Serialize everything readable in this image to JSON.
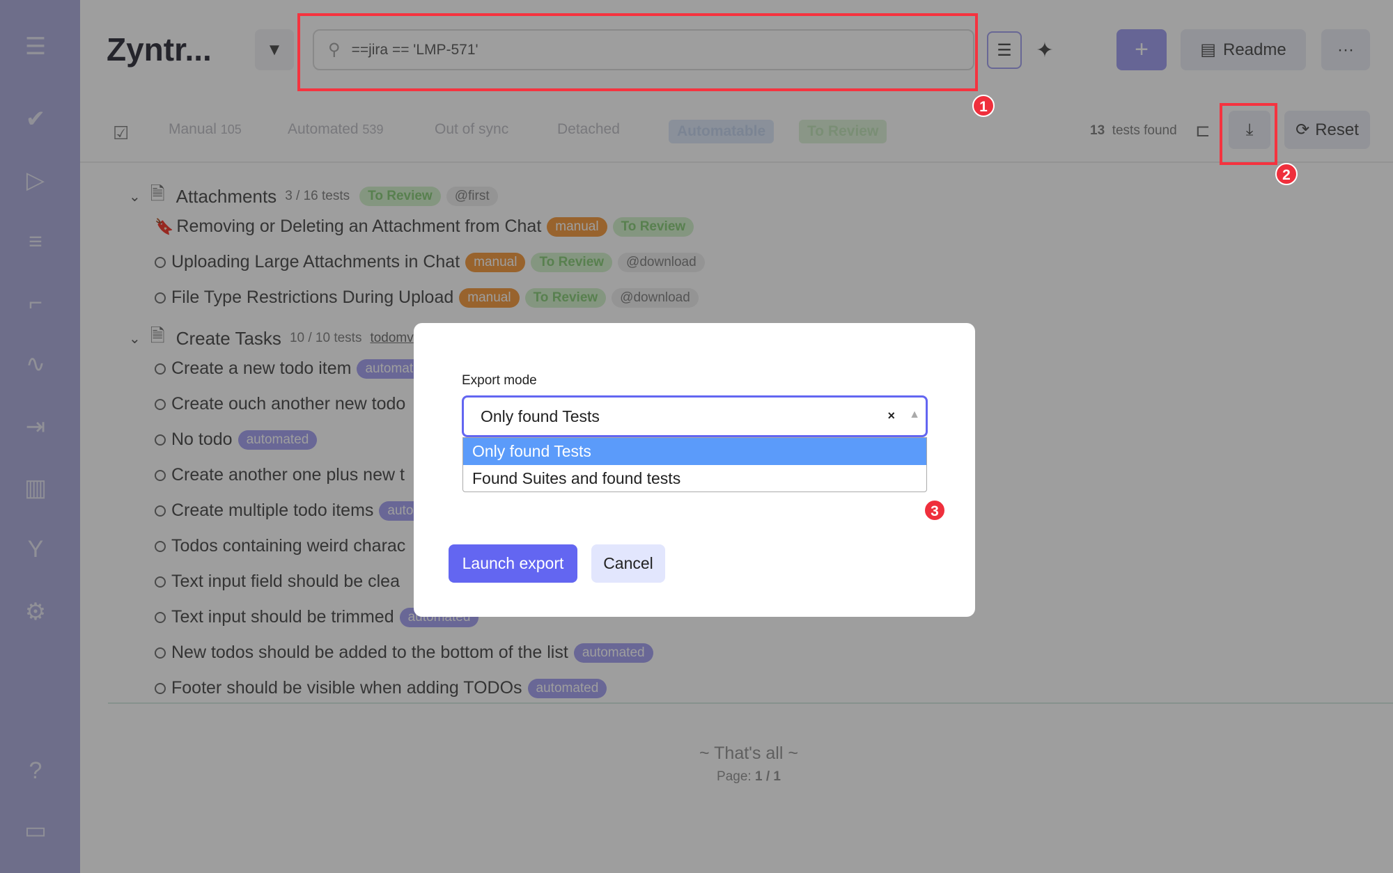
{
  "app": {
    "title": "Zyntr..."
  },
  "sidebar": {
    "items": [
      {
        "name": "menu",
        "glyph": "☰"
      },
      {
        "name": "tests",
        "glyph": "✔"
      },
      {
        "name": "runs",
        "glyph": "▷"
      },
      {
        "name": "plans",
        "glyph": "≡"
      },
      {
        "name": "steps",
        "glyph": "⌐"
      },
      {
        "name": "pulse",
        "glyph": "∿"
      },
      {
        "name": "imports",
        "glyph": "⇥"
      },
      {
        "name": "analytics",
        "glyph": "▥"
      },
      {
        "name": "branches",
        "glyph": "Y"
      },
      {
        "name": "settings",
        "glyph": "⚙"
      },
      {
        "name": "help",
        "glyph": "?"
      },
      {
        "name": "projects",
        "glyph": "▭"
      }
    ]
  },
  "header": {
    "search_value": "==jira == 'LMP-571'",
    "readme_label": "Readme",
    "more_label": "···",
    "plus_label": "+"
  },
  "tabs": [
    {
      "label": "Manual",
      "count": "105"
    },
    {
      "label": "Automated",
      "count": "539"
    },
    {
      "label": "Out of sync",
      "count": ""
    },
    {
      "label": "Detached",
      "count": ""
    }
  ],
  "pill_tabs": {
    "automatable": "Automatable",
    "to_review": "To Review"
  },
  "results": {
    "count": "13",
    "label": "tests found",
    "reset_label": "Reset"
  },
  "suites": [
    {
      "name": "Attachments",
      "count": "3 / 16 tests",
      "pills": [
        {
          "t": "To Review",
          "c": "review"
        },
        {
          "t": "@first",
          "c": "tag"
        }
      ],
      "tests": [
        {
          "name": "Removing or Deleting an Attachment from Chat",
          "flag": true,
          "pills": [
            {
              "t": "manual",
              "c": "manual"
            },
            {
              "t": "To Review",
              "c": "review"
            }
          ]
        },
        {
          "name": "Uploading Large Attachments in Chat",
          "pills": [
            {
              "t": "manual",
              "c": "manual"
            },
            {
              "t": "To Review",
              "c": "review"
            },
            {
              "t": "@download",
              "c": "tag"
            }
          ]
        },
        {
          "name": "File Type Restrictions During Upload",
          "pills": [
            {
              "t": "manual",
              "c": "manual"
            },
            {
              "t": "To Review",
              "c": "review"
            },
            {
              "t": "@download",
              "c": "tag"
            }
          ]
        }
      ]
    },
    {
      "name": "Create Tasks",
      "count": "10 / 10 tests",
      "link": "todomv",
      "pills": [],
      "tests": [
        {
          "name": "Create a new todo item",
          "pills": [
            {
              "t": "automated",
              "c": "auto"
            }
          ]
        },
        {
          "name": "Create ouch another new todo",
          "pills": []
        },
        {
          "name": "No todo",
          "pills": [
            {
              "t": "automated",
              "c": "auto"
            }
          ]
        },
        {
          "name": "Create another one plus new t",
          "pills": []
        },
        {
          "name": "Create multiple todo items",
          "pills": [
            {
              "t": "automated",
              "c": "auto"
            }
          ]
        },
        {
          "name": "Todos containing weird charac",
          "pills": []
        },
        {
          "name": "Text input field should be clea",
          "pills": []
        },
        {
          "name": "Text input should be trimmed",
          "pills": [
            {
              "t": "automated",
              "c": "auto"
            }
          ]
        },
        {
          "name": "New todos should be added to the bottom of the list",
          "pills": [
            {
              "t": "automated",
              "c": "auto"
            }
          ]
        },
        {
          "name": "Footer should be visible when adding TODOs",
          "pills": [
            {
              "t": "automated",
              "c": "auto"
            }
          ]
        }
      ]
    }
  ],
  "footer": {
    "end_text": "~ That's all ~",
    "page_label": "Page:",
    "page_value": "1 / 1"
  },
  "modal": {
    "label": "Export mode",
    "selected": "Only found Tests",
    "clear": "×",
    "options": [
      "Only found Tests",
      "Found Suites and found tests"
    ],
    "launch_label": "Launch export",
    "cancel_label": "Cancel"
  },
  "annotations": [
    "1",
    "2",
    "3"
  ],
  "colors": {
    "accent": "#6366f1",
    "highlight": "#5b9bfa",
    "annotation": "#ef2f3c"
  }
}
